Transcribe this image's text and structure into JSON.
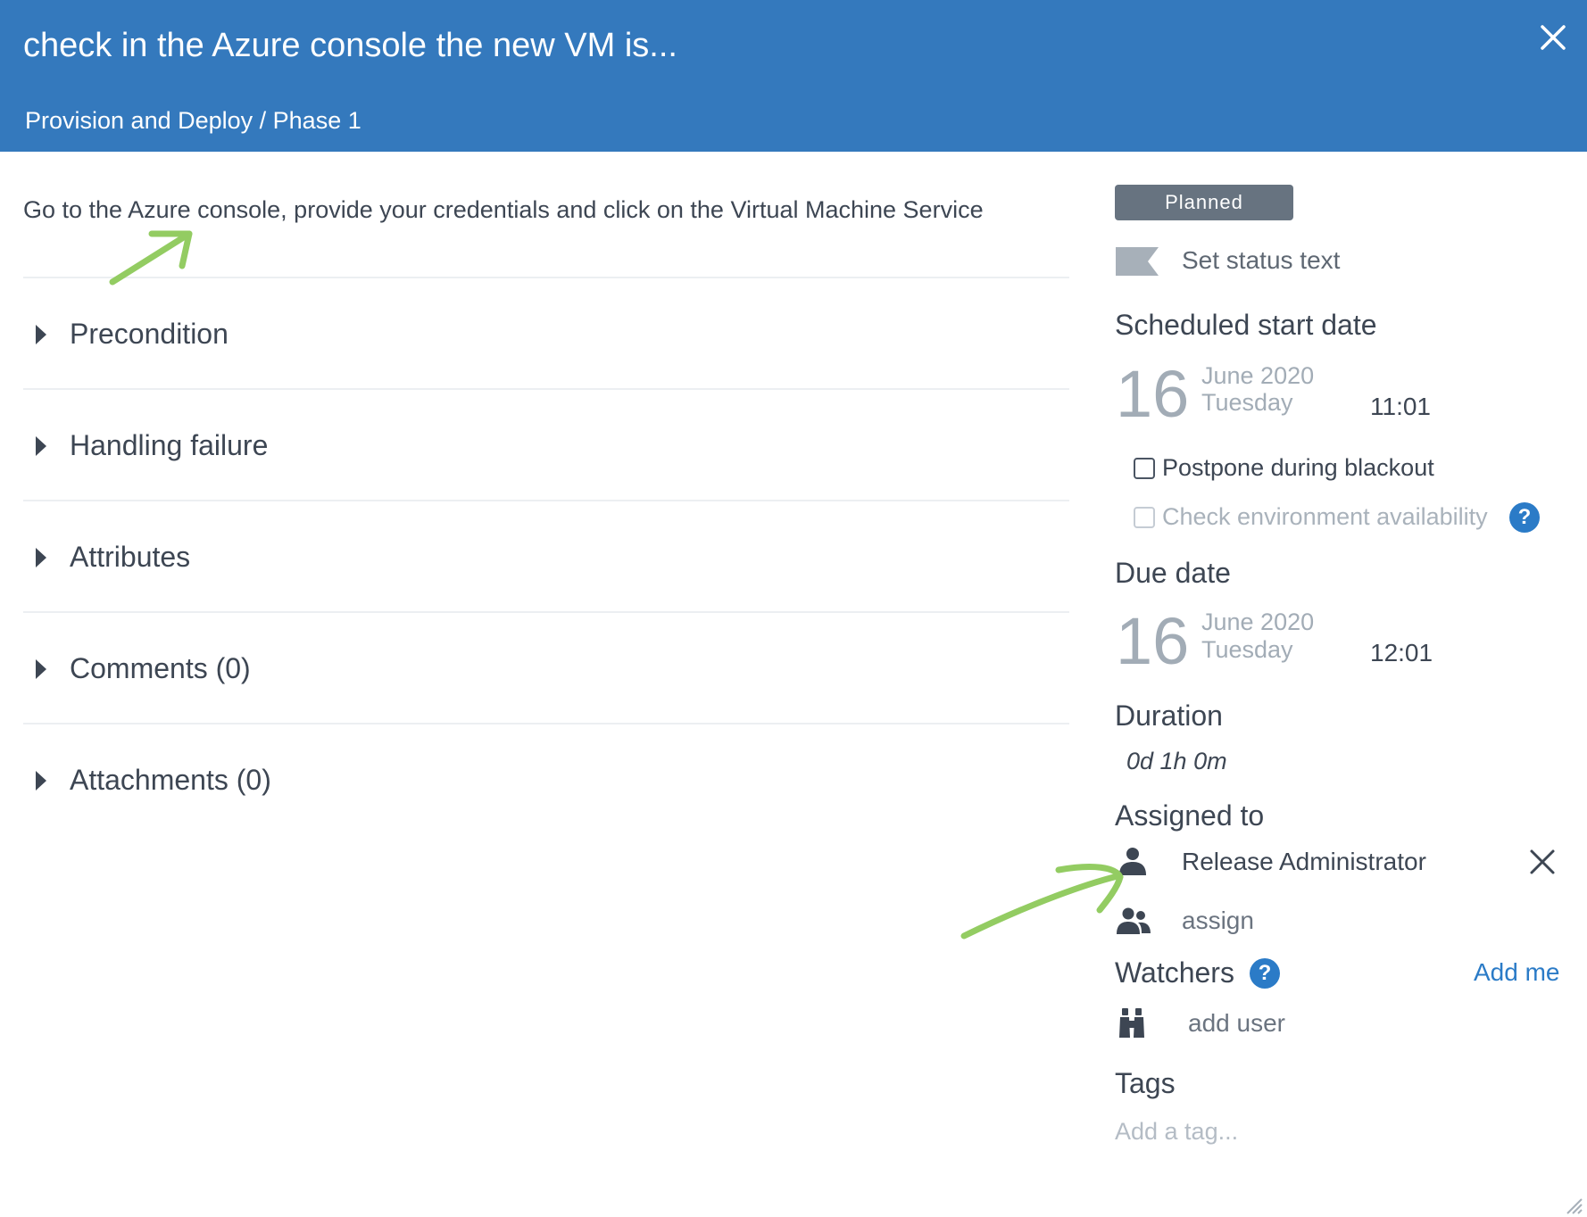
{
  "header": {
    "title": "check in the Azure console the new VM is...",
    "breadcrumb": "Provision and Deploy / Phase 1",
    "bg_color": "#3479bd"
  },
  "description": "Go to the Azure console, provide your credentials and click on the Virtual Machine Service",
  "sections": [
    {
      "label": "Precondition"
    },
    {
      "label": "Handling failure"
    },
    {
      "label": "Attributes"
    },
    {
      "label": "Comments (0)"
    },
    {
      "label": "Attachments (0)"
    }
  ],
  "status": {
    "badge": "Planned",
    "badge_color": "#677380",
    "set_status_text": "Set status text"
  },
  "scheduled_start": {
    "heading": "Scheduled start date",
    "day": "16",
    "month_year": "June 2020",
    "weekday": "Tuesday",
    "time": "11:01"
  },
  "options": {
    "postpone_label": "Postpone during blackout",
    "check_env_label": "Check environment availability"
  },
  "due": {
    "heading": "Due date",
    "day": "16",
    "month_year": "June 2020",
    "weekday": "Tuesday",
    "time": "12:01"
  },
  "duration": {
    "heading": "Duration",
    "value": "0d 1h 0m"
  },
  "assigned": {
    "heading": "Assigned to",
    "user": "Release Administrator",
    "assign_label": "assign"
  },
  "watchers": {
    "heading": "Watchers",
    "add_me": "Add me",
    "add_user": "add user"
  },
  "tags": {
    "heading": "Tags",
    "placeholder": "Add a tag..."
  },
  "annotation_color": "#93cc62",
  "link_color": "#2b7bc7"
}
